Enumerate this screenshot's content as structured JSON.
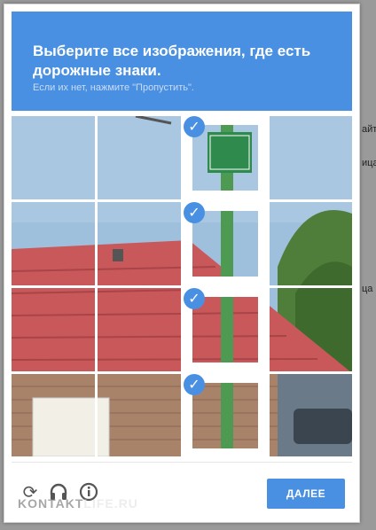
{
  "captcha": {
    "instruction_line1": "Выберите все изображения, где есть",
    "instruction_line2": "дорожные знаки.",
    "hint": "Если их нет, нажмите \"Пропустить\".",
    "verify_label": "ДАЛЕЕ",
    "tiles": [
      {
        "selected": false
      },
      {
        "selected": false
      },
      {
        "selected": true
      },
      {
        "selected": false
      },
      {
        "selected": false
      },
      {
        "selected": false
      },
      {
        "selected": true
      },
      {
        "selected": false
      },
      {
        "selected": false
      },
      {
        "selected": false
      },
      {
        "selected": true
      },
      {
        "selected": false
      },
      {
        "selected": false
      },
      {
        "selected": false
      },
      {
        "selected": true
      },
      {
        "selected": false
      }
    ],
    "footer_icons": [
      "reload-icon",
      "audio-icon",
      "info-icon"
    ],
    "check_glyph": "✓"
  },
  "watermark": {
    "part1": "KONTAKT",
    "part2": "LIFE.RU"
  },
  "background": {
    "snippets": [
      "айт",
      "ица",
      "ца"
    ]
  },
  "colors": {
    "accent": "#4a90e2",
    "sky": "#9fc0dc",
    "roof": "#c9585b",
    "brick": "#a9826a",
    "pole": "#4e9a53",
    "sign": "#2f8a4d"
  }
}
